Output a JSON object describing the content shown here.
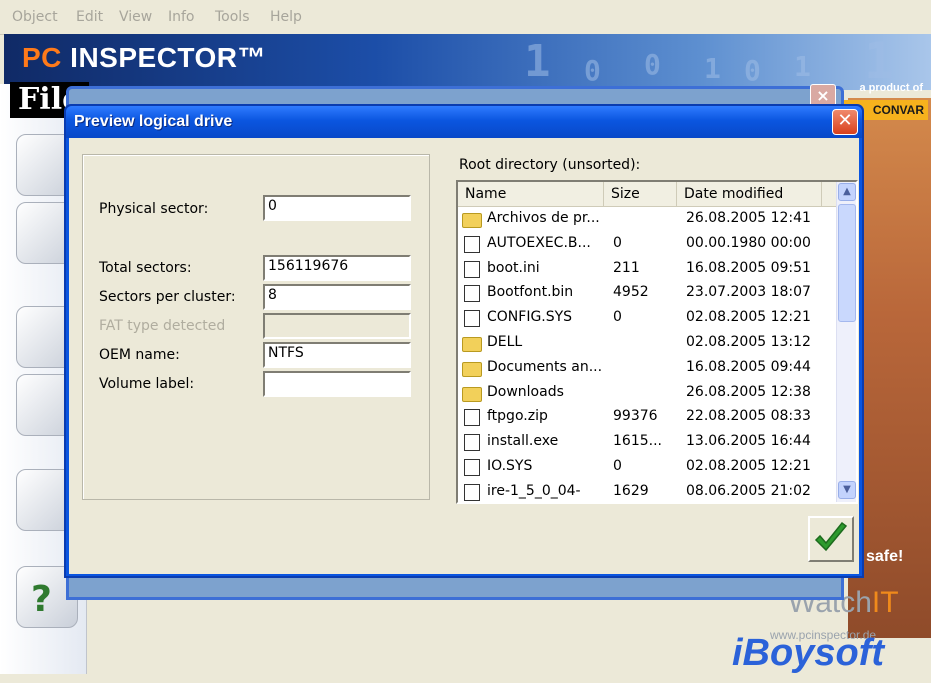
{
  "menu": [
    "Object",
    "Edit",
    "View",
    "Info",
    "Tools",
    "Help"
  ],
  "banner": {
    "logo_pc": "PC",
    "logo_rest": " INSPECTOR™",
    "product_of": "a product of",
    "convar": "CONVAR"
  },
  "left_panel": {
    "file_label": "File"
  },
  "right_panel": {
    "safe": "safe!",
    "watch": "Watch",
    "it": "IT",
    "url": "www.pcinspector.de"
  },
  "watermark": "iBoysoft",
  "dialog": {
    "title": "Preview logical drive",
    "close_label": "✕",
    "fields": {
      "physical_sector": {
        "label": "Physical sector:",
        "value": "0"
      },
      "total_sectors": {
        "label": "Total sectors:",
        "value": "156119676"
      },
      "sectors_per_cluster": {
        "label": "Sectors per cluster:",
        "value": "8"
      },
      "fat_type": {
        "label": "FAT type detected",
        "value": ""
      },
      "oem_name": {
        "label": "OEM name:",
        "value": "NTFS"
      },
      "volume_label": {
        "label": "Volume label:",
        "value": ""
      }
    },
    "root_label": "Root directory (unsorted):",
    "columns": {
      "name": "Name",
      "size": "Size",
      "date": "Date modified"
    },
    "files": [
      {
        "icon": "folder-icon",
        "name": "Archivos de pr...",
        "size": "",
        "date": "26.08.2005 12:41"
      },
      {
        "icon": "file-icon",
        "name": "AUTOEXEC.B...",
        "size": "0",
        "date": "00.00.1980 00:00"
      },
      {
        "icon": "file-icon",
        "name": "boot.ini",
        "size": "211",
        "date": "16.08.2005 09:51"
      },
      {
        "icon": "file-icon",
        "name": "Bootfont.bin",
        "size": "4952",
        "date": "23.07.2003 18:07"
      },
      {
        "icon": "file-icon",
        "name": "CONFIG.SYS",
        "size": "0",
        "date": "02.08.2005 12:21"
      },
      {
        "icon": "folder-icon",
        "name": "DELL",
        "size": "",
        "date": "02.08.2005 13:12"
      },
      {
        "icon": "folder-icon",
        "name": "Documents an...",
        "size": "",
        "date": "16.08.2005 09:44"
      },
      {
        "icon": "folder-icon",
        "name": "Downloads",
        "size": "",
        "date": "26.08.2005 12:38"
      },
      {
        "icon": "file-icon",
        "name": "ftpgo.zip",
        "size": "99376",
        "date": "22.08.2005 08:33"
      },
      {
        "icon": "file-icon",
        "name": "install.exe",
        "size": "1615...",
        "date": "13.06.2005 16:44"
      },
      {
        "icon": "file-icon",
        "name": "IO.SYS",
        "size": "0",
        "date": "02.08.2005 12:21"
      },
      {
        "icon": "file-icon",
        "name": "ire-1_5_0_04-",
        "size": "1629",
        "date": "08.06.2005 21:02"
      }
    ],
    "ok_icon": "checkmark-icon"
  }
}
